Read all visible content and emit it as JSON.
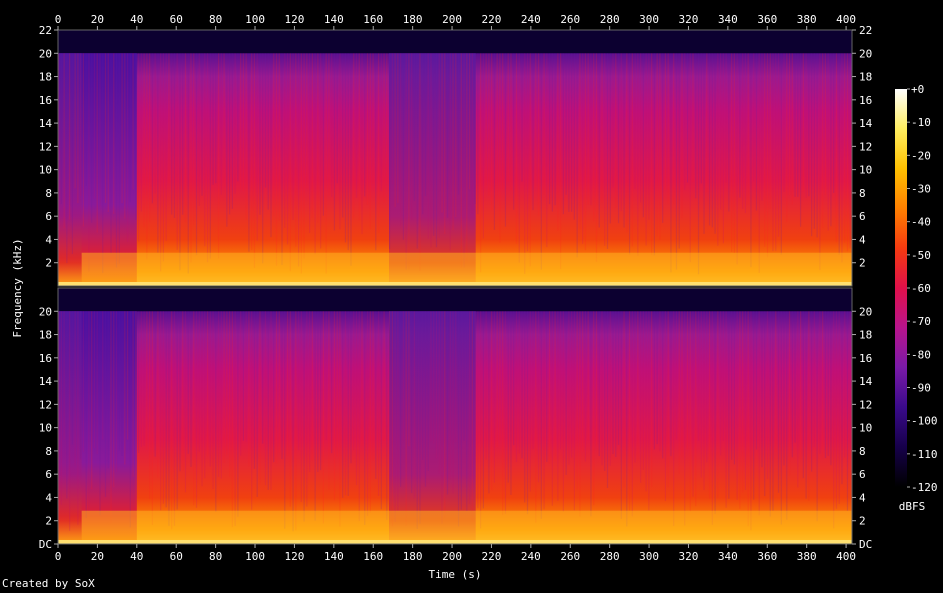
{
  "chart_data": {
    "type": "heatmap",
    "subtype": "spectrogram",
    "channels": 2,
    "xlabel": "Time (s)",
    "ylabel": "Frequency (kHz)",
    "x_ticks": [
      0,
      20,
      40,
      60,
      80,
      100,
      120,
      140,
      160,
      180,
      200,
      220,
      240,
      260,
      280,
      300,
      320,
      340,
      360,
      380,
      400
    ],
    "xlim": [
      0,
      403
    ],
    "y_ticks_top": [
      "2",
      "4",
      "6",
      "8",
      "10",
      "12",
      "14",
      "16",
      "18",
      "20",
      "22"
    ],
    "y_ticks_bottom": [
      "DC",
      "2",
      "4",
      "6",
      "8",
      "10",
      "12",
      "14",
      "16",
      "18",
      "20"
    ],
    "ylim_khz": [
      0,
      22
    ],
    "colorbar": {
      "unit": "dBFS",
      "ticks": [
        "+0",
        "-10",
        "-20",
        "-30",
        "-40",
        "-50",
        "-60",
        "-70",
        "-80",
        "-90",
        "-100",
        "-110",
        "-120"
      ],
      "range": [
        -120,
        0
      ],
      "stops": [
        "#000000",
        "#16004a",
        "#3a0a8a",
        "#7a1aa8",
        "#b8148c",
        "#e0104a",
        "#f53a10",
        "#ff8000",
        "#ffc000",
        "#ffee60",
        "#ffffff"
      ]
    },
    "credit": "Created by SoX"
  }
}
